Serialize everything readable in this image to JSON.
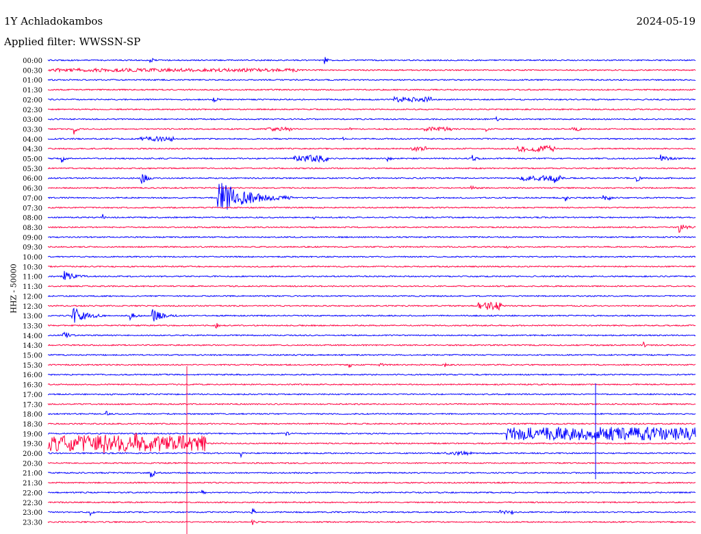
{
  "header": {
    "station": "1Y Achladokambos",
    "date": "2024-05-19",
    "filter": "Applied filter: WWSSN-SP"
  },
  "chart_data": {
    "type": "line",
    "title": "1Y Achladokambos",
    "ylabel": "HHZ - 50000",
    "colors": [
      "#0000ff",
      "#ff0040"
    ],
    "time_labels": [
      "00:00",
      "00:30",
      "01:00",
      "01:30",
      "02:00",
      "02:30",
      "03:00",
      "03:30",
      "04:00",
      "04:30",
      "05:00",
      "05:30",
      "06:00",
      "06:30",
      "07:00",
      "07:30",
      "08:00",
      "08:30",
      "09:00",
      "09:30",
      "10:00",
      "10:30",
      "11:00",
      "11:30",
      "12:00",
      "12:30",
      "13:00",
      "13:30",
      "14:00",
      "14:30",
      "15:00",
      "15:30",
      "16:00",
      "16:30",
      "17:00",
      "17:30",
      "18:00",
      "18:30",
      "19:00",
      "19:30",
      "20:00",
      "20:30",
      "21:00",
      "21:30",
      "22:00",
      "22:30",
      "23:00",
      "23:30"
    ],
    "row_minutes": 30
  }
}
